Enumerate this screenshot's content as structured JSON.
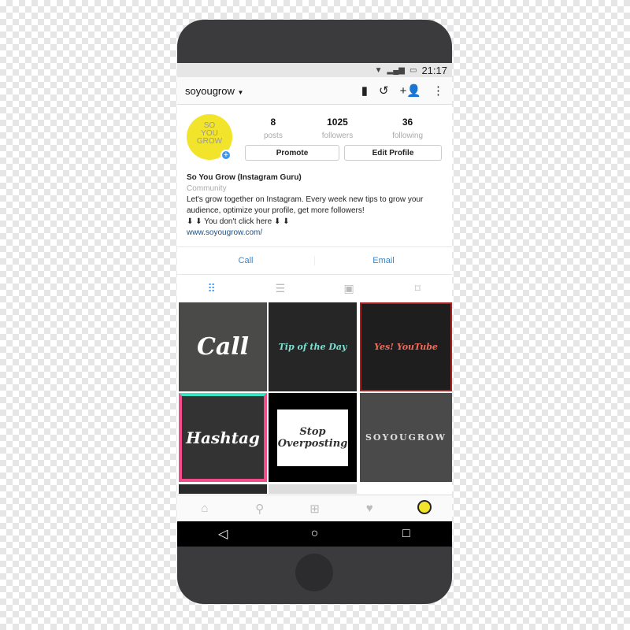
{
  "status": {
    "time": "21:17",
    "icons": [
      "wifi-icon",
      "signal-icon",
      "battery-icon"
    ]
  },
  "header": {
    "username": "soyougrow",
    "icons": [
      "insights-icon",
      "archive-icon",
      "add-person-icon",
      "more-icon"
    ]
  },
  "profile": {
    "avatar_text": "SO YOU GROW",
    "posts": "8",
    "posts_label": "posts",
    "followers": "1025",
    "followers_label": "followers",
    "following": "36",
    "following_label": "following",
    "promote": "Promote",
    "edit": "Edit Profile"
  },
  "bio": {
    "name": "So You Grow (Instagram Guru)",
    "category": "Community",
    "line1": "Let's grow together on Instagram. Every week new tips to grow your",
    "line2": "audience, optimize your profile, get more followers!",
    "line3": "⬇ ⬇ You don't click here ⬇ ⬇",
    "link": "www.soyougrow.com/"
  },
  "contact": {
    "call": "Call",
    "email": "Email"
  },
  "tabs": [
    "grid-icon",
    "list-icon",
    "tagged-icon",
    "saved-icon"
  ],
  "posts": [
    {
      "text": "Call"
    },
    {
      "text": "Tip of the Day"
    },
    {
      "text": "Yes! YouTube"
    },
    {
      "text": "Hashtag"
    },
    {
      "text": "Stop Overposting"
    },
    {
      "text": "SOYOUGROW"
    }
  ],
  "bottom_nav": [
    "home-icon",
    "search-icon",
    "add-icon",
    "heart-icon",
    "profile-icon"
  ],
  "colors": {
    "accent": "#3897f0",
    "brand": "#f2e42a"
  }
}
